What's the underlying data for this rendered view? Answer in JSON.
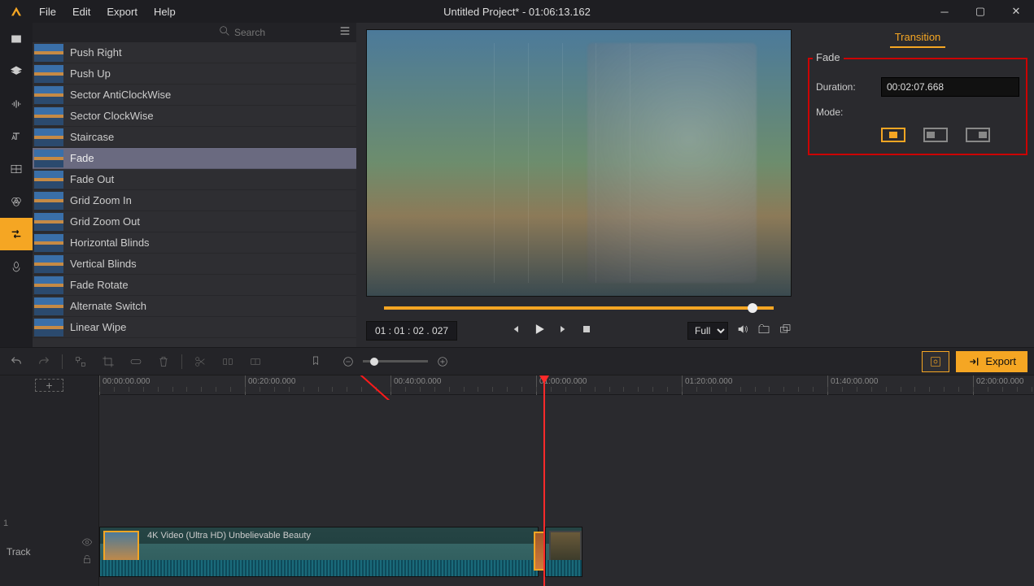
{
  "menu": {
    "file": "File",
    "edit": "Edit",
    "export": "Export",
    "help": "Help"
  },
  "title": "Untitled Project* - 01:06:13.162",
  "search": {
    "placeholder": "Search"
  },
  "transitions": [
    "Push Right",
    "Push Up",
    "Sector AntiClockWise",
    "Sector ClockWise",
    "Staircase",
    "Fade",
    "Fade Out",
    "Grid Zoom In",
    "Grid Zoom Out",
    "Horizontal Blinds",
    "Vertical Blinds",
    "Fade Rotate",
    "Alternate Switch",
    "Linear Wipe"
  ],
  "selected_transition_index": 5,
  "preview": {
    "timecode": "01 : 01 : 02 . 027",
    "fit": "Full"
  },
  "props": {
    "tab": "Transition",
    "section": "Fade",
    "duration_label": "Duration:",
    "duration_value": "00:02:07.668",
    "mode_label": "Mode:"
  },
  "toolbar": {
    "export": "Export"
  },
  "ruler": [
    "00:00:00.000",
    "00:20:00.000",
    "00:40:00.000",
    "01:00:00.000",
    "01:20:00.000",
    "01:40:00.000",
    "02:00:00.000"
  ],
  "track": {
    "num": "1",
    "label": "Track"
  },
  "clip": {
    "title": "4K Video (Ultra HD) Unbelievable Beauty"
  }
}
